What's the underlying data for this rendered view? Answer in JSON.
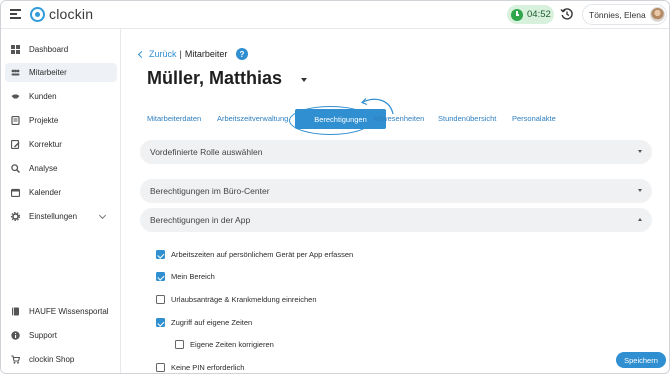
{
  "app": {
    "name": "clockin"
  },
  "topbar": {
    "timer": "04:52",
    "user_name": "Tönnies, Elena"
  },
  "sidebar": {
    "items": [
      {
        "label": "Dashboard",
        "icon": "dashboard-icon",
        "active": false
      },
      {
        "label": "Mitarbeiter",
        "icon": "users-icon",
        "active": true
      },
      {
        "label": "Kunden",
        "icon": "handshake-icon",
        "active": false
      },
      {
        "label": "Projekte",
        "icon": "projects-icon",
        "active": false
      },
      {
        "label": "Korrektur",
        "icon": "edit-icon",
        "active": false
      },
      {
        "label": "Analyse",
        "icon": "analysis-icon",
        "active": false
      },
      {
        "label": "Kalender",
        "icon": "calendar-icon",
        "active": false
      },
      {
        "label": "Einstellungen",
        "icon": "gear-icon",
        "active": false
      }
    ],
    "footer_items": [
      {
        "label": "HAUFE Wissensportal",
        "icon": "book-icon"
      },
      {
        "label": "Support",
        "icon": "info-icon"
      },
      {
        "label": "clockin Shop",
        "icon": "cart-icon"
      }
    ]
  },
  "breadcrumb": {
    "back": "Zurück",
    "separator": "|",
    "current": "Mitarbeiter"
  },
  "page_title": "Müller, Matthias",
  "tabs": [
    {
      "label": "Mitarbeiterdaten"
    },
    {
      "label": "Arbeitszeitverwaltung"
    },
    {
      "label": "Berechtigungen",
      "active": true
    },
    {
      "label": "Abwesenheiten"
    },
    {
      "label": "Stundenübersicht"
    },
    {
      "label": "Personalakte"
    }
  ],
  "accordions": {
    "role": "Vordefinierte Rolle auswählen",
    "office": "Berechtigungen im Büro-Center",
    "app": "Berechtigungen in der App"
  },
  "permissions": [
    {
      "label": "Arbeitszeiten auf persönlichem Gerät per App erfassen",
      "checked": true
    },
    {
      "label": "Mein Bereich",
      "checked": true
    },
    {
      "label": "Urlaubsanträge & Krankmeldung einreichen",
      "checked": false
    },
    {
      "label": "Zugriff auf eigene Zeiten",
      "checked": true
    },
    {
      "label": "Eigene Zeiten korrigieren",
      "checked": false
    },
    {
      "label": "Keine PIN erforderlich",
      "checked": false
    }
  ],
  "actions": {
    "save": "Speichern"
  },
  "colors": {
    "accent": "#2f8fd0",
    "timer_bg": "#d7f1dc",
    "timer_icon": "#2fa64b"
  }
}
